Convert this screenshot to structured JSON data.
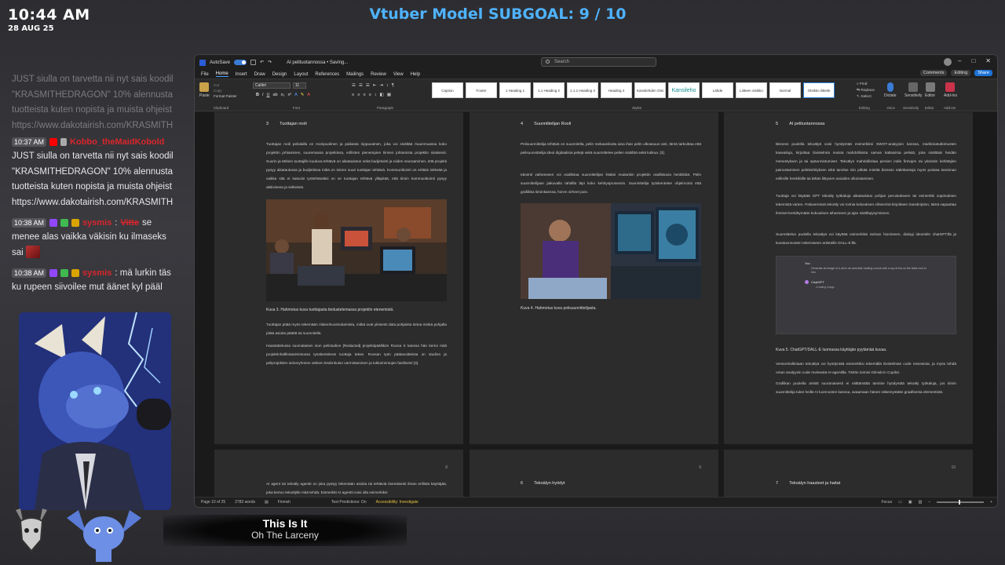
{
  "overlay": {
    "time": "10:44 AM",
    "date": "28 AUG 25",
    "subgoal": "Vtuber Model SUBGOAL: 9 / 10",
    "now_playing": {
      "title": "This Is It",
      "artist": "Oh The Larceny"
    }
  },
  "chat": {
    "faded_lines": [
      "JUST siulla on tarvetta nii nyt sais koodill",
      "\"KRASMITHEDRAGON\" 10% alennusta T",
      "tuotteista kuten nopista ja muista ohjeist",
      "https://www.dakotairish.com/KRASMITH"
    ],
    "messages": [
      {
        "time": "10:37 AM",
        "user": "Kobbo_theMaidKobold",
        "user_color": "#d9262c",
        "lines": [
          "JUST siulla on tarvetta nii nyt sais koodill",
          "\"KRASMITHEDRAGON\" 10% alennusta T",
          "tuotteista kuten nopista ja muista ohjeist",
          "https://www.dakotairish.com/KRASMITH"
        ]
      },
      {
        "time": "10:38 AM",
        "user": "sysmis",
        "user_color": "#d9262c",
        "mention": "Vitte",
        "first": " se",
        "lines": [
          "menee alas vaikka väkisin ku ilmaseks",
          "sai"
        ]
      },
      {
        "time": "10:38 AM",
        "user": "sysmis",
        "user_color": "#d9262c",
        "first": ": mä lurkin täs",
        "lines": [
          "ku rupeen siivoilee mut äänet kyl pääl"
        ]
      }
    ]
  },
  "word": {
    "autosave_label": "AutoSave",
    "doc_title": "AI pelituotannossa • Saving...",
    "search_placeholder": "Search",
    "menus": [
      "File",
      "Home",
      "Insert",
      "Draw",
      "Design",
      "Layout",
      "References",
      "Mailings",
      "Review",
      "View",
      "Help"
    ],
    "active_menu": "Home",
    "comments_label": "Comments",
    "editing_label": "Editing",
    "share_label": "Share",
    "paste_label": "Paste",
    "cut_label": "Cut",
    "copy_label": "Copy",
    "format_painter_label": "Format Painter",
    "font_name": "Calibri",
    "font_size": "11",
    "group_labels": {
      "clipboard": "Clipboard",
      "font": "Font",
      "paragraph": "Paragraph",
      "styles": "Styles",
      "editing": "Editing",
      "voice": "Voice",
      "sensitivity": "Sensitivity",
      "editor": "Editor",
      "addins": "Add-ins"
    },
    "styles": [
      "Caption",
      "Footer",
      "1 Heading 1",
      "1.1 Heading 2",
      "1.1.1 Heading 3",
      "Heading 4",
      "Kansilehden Otsi",
      "Kansileho",
      "Lähde",
      "Liitteen otsikko",
      "Normal",
      "Otsikko liitteile"
    ],
    "find_label": "Find",
    "replace_label": "Replace",
    "select_label": "Select",
    "dictate_label": "Dictate",
    "sensitivity_label": "Sensitivity",
    "editor_label": "Editor",
    "addins_label": "Add-ins",
    "status": {
      "page": "Page 10 of 25",
      "words": "2782 words",
      "language": "Finnish",
      "predictions": "Text Predictions: On",
      "accessibility": "Accessibility: Investigate",
      "focus": "Focus"
    }
  },
  "pages": {
    "p1": {
      "heading_num": "3",
      "heading": "Tuottajan rooli",
      "para1": "Tuottajan rooli pelialalla on monipuolinen ja paikasta riippuvainen, joka voi sisältää muunmuassa koko projektin johtaminen, suuremassa projektissa, erillisten pienempien tiimien johtamista projektin sisäisesti. Suurin ja tärkein tuottajille kuuluva tehtävä on aikataulutus sekä budjetointi ja niiden seuraaminen, että projekti pysyy aikataulussa ja budjettissa mikä on toinen suuri tuottajan tehtävä. Kommunikointi on erittäin tärkeää ja vaikka sitä ei katsoisi työtehtäväksi on se tuottajan tehtävä ylläpitää, että tiimin kommunikointi pysyy aktiivisena ja selkeänä.",
      "caption": "Kuva 3. Hahmotus kuva tuottajasta tiedustelemassa projektin etenemistä.",
      "para2": "Tuottajan pitää myös tekemään riskienhuomioitamista, mitkä ovat yleisesti data pohjaista tietoa minkä pohjalta pitää asioita päättä tai suunnitella.",
      "para3": "Haastattelussa suomalaisen ison pelistudion [Redacted] projektipäällikön Roosa S kanssa hän kertoi mitä projektinhallintatoimistossa työskentelevä tuottaja tekee. Roosan työn päätavoitteista on studion ja peliprojektien sidosryhmien välinen tiedonkulun varmistaminen ja tukitoimintojen fasilitointi [3]."
    },
    "p2": {
      "heading_num": "4",
      "heading": "Suunnittelijan Rooli",
      "para1": "Pelisuunnittelija tehtävä on suunnitella, pelin mekaanikoita aina ihan pelin ulkoasuun asti, tämä tarkoittaa että pelisuunnittelija ideoi digitaalisia pelejä sekä suunnittelee pelien sisällöä sekä kulkua. [3].",
      "para2": "Ideointi vaiheeseen voi osallistua suunnittelijan lisäksi muitankin projektin osallistuvia henkilöitä. Pelin suunnittelijaan jatkuvalla tahdilla läpi koko kehitysprosessin. Suunnittelija työskentelee ohjelmointi että grafiikka tiiminkanssa, hio'en virheet pois.",
      "caption": "Kuva 4. Hahmotus kuva pelisuunnittelijasta."
    },
    "p3": {
      "heading_num": "5",
      "heading": "AI pelituotannossa",
      "para1": "Bisness puolella tekoälyä voisi hyödyntää esimerkiksi SWOT-analyysin kanssa, markkinatutkimusten kaavailuja, kirjoittaa tiivistelmiä muista mahdollisista saman kaltaisista pelistä, joka sisältäisi heidän menestyksen ja tai epäonnistumiset. Tekoälyn mahdollisitaa pienien indie firmojen tai yksinäin kehittäjien painostaminen pelinkehityksen eikä tarvitse niin pitkää mietitä bisness näkökantoja myös poistaa tarvinnan erillisille henkilöille tai tähän liittyvien asioiden ulkoistamisen.",
      "para2": "Tuottaja voi käyttää GPT tekoäly työkaluja aikataulutus pohjan perustukseen tai esimerkki sopimuksen tekemistä varten. Palavereissä tekoäly voi toimia kokouksen sihteerinä kirjoittaen transkription, tämä vapauttaa ihmiset keskittymään kokouksen aiheeseen ja ajan sisällöpysymiseen.",
      "para3": "Suunnittelun puolella tekoälyä voi käyttää esimerkiksi tarinan hiomiseen, dialogi ideointiin chatGPT:llä ja kuvaluonnosten tekemiseen artisteille DALL-E:llä.",
      "chat_you": "You",
      "chat_prompt": "Generate an image of a cat in an armchair reading a book with a cup of tea on the table next to him.",
      "chat_bot": "ChatGPT",
      "chat_status": "Creating image",
      "caption": "Kuva 5. ChatGPT/DALL-E luomassa käyttäjän pyytämää kuvaa.",
      "para4": "Versionhallintaan tekoälyä voi hyödyntää esimerkiksi tekemällä tiivistelmän code reviewista, ja myös tehdä oman analyysin code reviewstä AI-agentilla. Tähän toimisi GitHub:in Copilot.",
      "para5": "Grafiikan puolella artistit suoranaisesti ei välttämättä tarvitse hyödyntää tekoäly työkaluja, jos tiimin suunnittelija tulee heille AI luonnosten kanssa, avaamaan hänen näkemystään graafisesta elementistä."
    },
    "p4": {
      "num": "8",
      "para1": "AI agent tai tekoäly agentti on joka pystyy tekemään asioita tai tehtäviä itsenäisesti ilman erillistä käyttäjää, joka kertoo tekoälylle mitä tehdä. Esimerkki AI agentti voisi olla esimerkiksi"
    },
    "p5": {
      "num": "9",
      "heading_num": "6",
      "heading": "Tekoälyn hyödyt"
    },
    "p6": {
      "num": "10",
      "heading_num": "7",
      "heading": "Tekoälyn haasteet ja haitat"
    }
  },
  "colors": {
    "subgoal": "#4fb3ff",
    "word_accent": "#2b7fd9",
    "page_bg": "#2c2c2c"
  }
}
